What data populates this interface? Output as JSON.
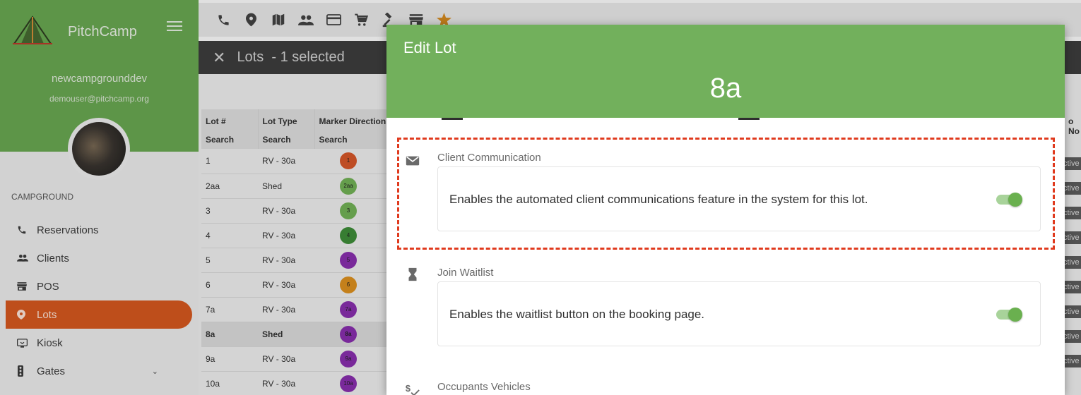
{
  "sidebar": {
    "brand": "PitchCamp",
    "username": "newcampgrounddev",
    "email": "demouser@pitchcamp.org",
    "section": "CAMPGROUND",
    "items": [
      {
        "label": "Reservations",
        "icon": "phone-icon"
      },
      {
        "label": "Clients",
        "icon": "people-icon"
      },
      {
        "label": "POS",
        "icon": "store-icon"
      },
      {
        "label": "Lots",
        "icon": "location-pin-icon",
        "active": true
      },
      {
        "label": "Kiosk",
        "icon": "kiosk-icon"
      },
      {
        "label": "Gates",
        "icon": "traffic-light-icon"
      }
    ]
  },
  "toolbar": {
    "icons": [
      "phone-icon",
      "location-pin-icon",
      "map-icon",
      "people-icon",
      "credit-card-icon",
      "cart-icon",
      "gavel-icon",
      "store-icon",
      "star-icon"
    ]
  },
  "selection": {
    "title": "Lots  - 1 selected"
  },
  "table": {
    "headers": [
      {
        "label": "Lot #",
        "search": "Search"
      },
      {
        "label": "Lot Type",
        "search": "Search"
      },
      {
        "label": "Marker Direction",
        "search": "Search"
      }
    ],
    "rows": [
      {
        "lot": "1",
        "type": "RV - 30a",
        "marker": "1",
        "color": "#d9582a"
      },
      {
        "lot": "2aa",
        "type": "Shed",
        "marker": "2aa",
        "color": "#74b457"
      },
      {
        "lot": "3",
        "type": "RV - 30a",
        "marker": "3",
        "color": "#74b457"
      },
      {
        "lot": "4",
        "type": "RV - 30a",
        "marker": "4",
        "color": "#3f8f3a"
      },
      {
        "lot": "5",
        "type": "RV - 30a",
        "marker": "5",
        "color": "#8a2fb0"
      },
      {
        "lot": "6",
        "type": "RV - 30a",
        "marker": "6",
        "color": "#e0921f"
      },
      {
        "lot": "7a",
        "type": "RV - 30a",
        "marker": "7a",
        "color": "#8a2fb0"
      },
      {
        "lot": "8a",
        "type": "Shed",
        "marker": "8a",
        "color": "#8a2fb0",
        "selected": true
      },
      {
        "lot": "9a",
        "type": "RV - 30a",
        "marker": "9a",
        "color": "#8a2fb0"
      },
      {
        "lot": "10a",
        "type": "RV - 30a",
        "marker": "10a",
        "color": "#8a2fb0"
      }
    ],
    "right_header": "o No",
    "status_badge": "ctive"
  },
  "modal": {
    "title": "Edit Lot",
    "lot_name": "8a",
    "settings": [
      {
        "label": "Client Communication",
        "icon": "envelope-icon",
        "description": "Enables the automated client communications feature in the system for this lot.",
        "enabled": true
      },
      {
        "label": "Join Waitlist",
        "icon": "hourglass-icon",
        "description": "Enables the waitlist button on the booking page.",
        "enabled": true
      },
      {
        "label": "Occupants Vehicles",
        "icon": "dollar-check-icon"
      }
    ]
  },
  "colors": {
    "primary_green": "#72b05c",
    "sidebar_green": "#6aaa52",
    "active_orange": "#d9591f",
    "highlight_red": "#e03a1e"
  }
}
